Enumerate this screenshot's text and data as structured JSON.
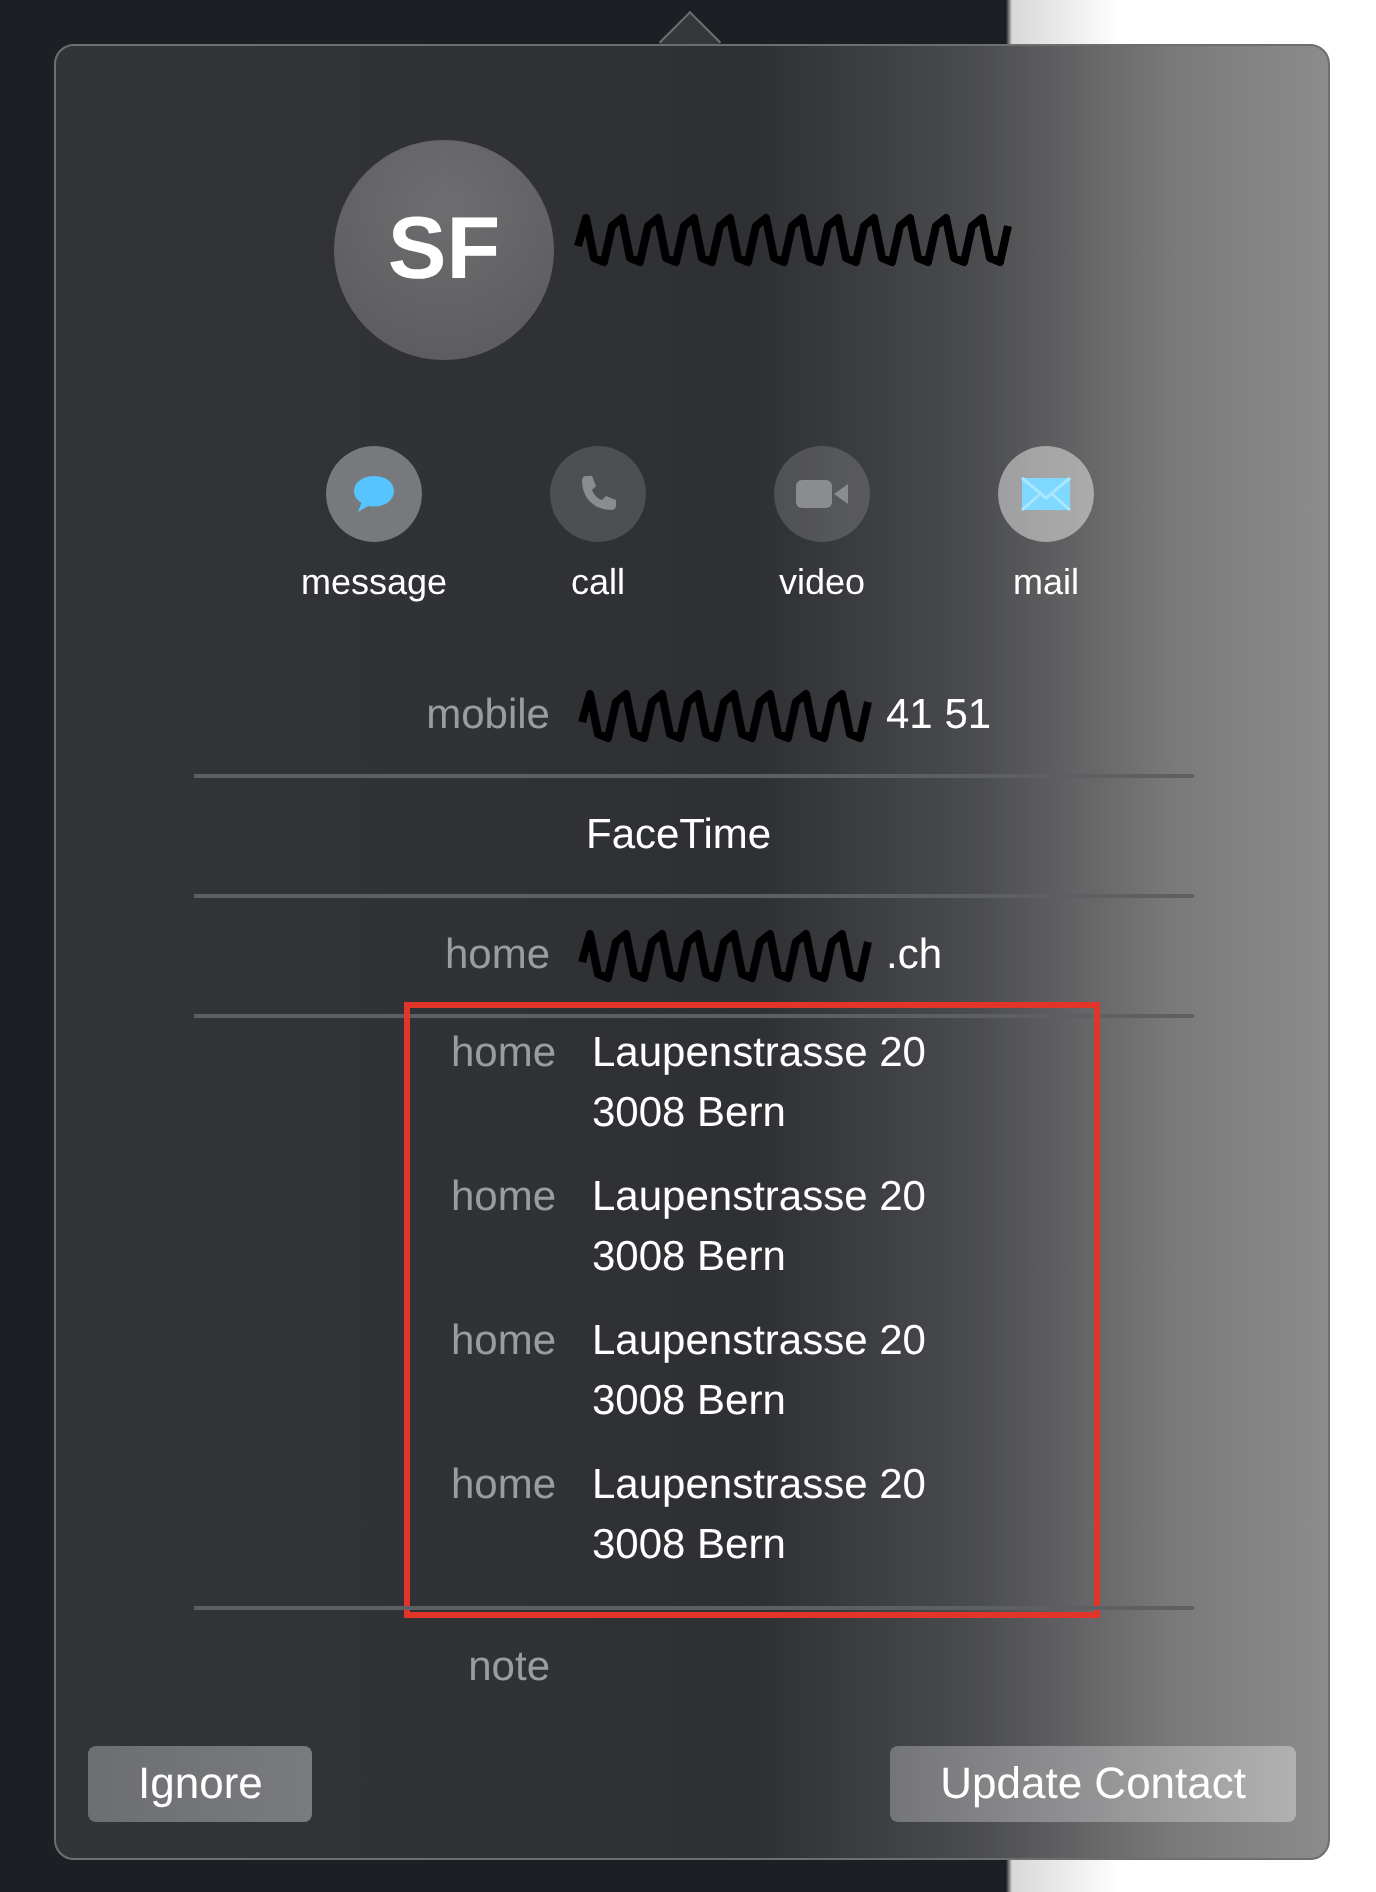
{
  "contact": {
    "initials": "SF",
    "name_redacted": true
  },
  "actions": [
    {
      "label": "message",
      "kind": "message"
    },
    {
      "label": "call",
      "kind": "call"
    },
    {
      "label": "video",
      "kind": "video"
    },
    {
      "label": "mail",
      "kind": "mail"
    }
  ],
  "fields": [
    {
      "label": "mobile",
      "value": "41 51",
      "redacted": true
    },
    {
      "value": "FaceTime",
      "redacted": false
    },
    {
      "label": "home",
      "value": ".ch",
      "redacted": true
    }
  ],
  "addresses": {
    "highlighted": true,
    "items": [
      {
        "label": "home",
        "lines": [
          "Laupenstrasse 20",
          "3008 Bern"
        ]
      },
      {
        "label": "home",
        "lines": [
          "Laupenstrasse 20",
          "3008 Bern"
        ]
      },
      {
        "label": "home",
        "lines": [
          "Laupenstrasse 20",
          "3008 Bern"
        ]
      },
      {
        "label": "home",
        "lines": [
          "Laupenstrasse 20",
          "3008 Bern"
        ]
      }
    ]
  },
  "note": {
    "label": "note"
  },
  "buttons": [
    {
      "label": "Ignore"
    },
    {
      "label": "Update Contact"
    }
  ]
}
